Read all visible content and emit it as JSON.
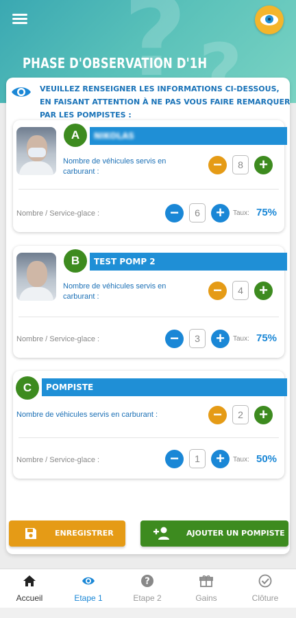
{
  "header": {
    "title": "PHASE D'OBSERVATION D'1H",
    "menu_icon": "hamburger-menu-icon",
    "logo_icon": "eye-logo-icon"
  },
  "info": {
    "text": "Veuillez renseigner les informations ci-dessous, en faisant attention à ne pas vous faire remarquer par les pompistes :"
  },
  "attendants": [
    {
      "letter": "A",
      "name": "NIKOLAS",
      "q_label": "Nombre de véhicules servis en carburant :",
      "fuel_count": "8",
      "service_label": "Nombre / Service-glace :",
      "service_count": "6",
      "taux_label": "Taux:",
      "taux_value": "75%"
    },
    {
      "letter": "B",
      "name": "TEST POMP 2",
      "q_label": "Nombre de véhicules servis en carburant :",
      "fuel_count": "4",
      "service_label": "Nombre / Service-glace :",
      "service_count": "3",
      "taux_label": "Taux:",
      "taux_value": "75%"
    },
    {
      "letter": "C",
      "name": "POMPISTE",
      "q_label": "Nombre de véhicules servis en carburant :",
      "fuel_count": "2",
      "service_label": "Nombre / Service-glace :",
      "service_count": "1",
      "taux_label": "Taux:",
      "taux_value": "50%"
    }
  ],
  "actions": {
    "save_label": "ENREGISTRER",
    "add_label": "AJOUTER UN POMPISTE"
  },
  "tabs": [
    {
      "label": "Accueil",
      "icon": "home-icon"
    },
    {
      "label": "Etape 1",
      "icon": "eye-icon"
    },
    {
      "label": "Etape 2",
      "icon": "question-icon"
    },
    {
      "label": "Gains",
      "icon": "gift-icon"
    },
    {
      "label": "Clôture",
      "icon": "check-circle-icon"
    }
  ],
  "colors": {
    "primary_blue": "#1a87d6",
    "orange": "#e59b16",
    "green": "#3d8b1f",
    "teal_header": "#58c0b9"
  }
}
